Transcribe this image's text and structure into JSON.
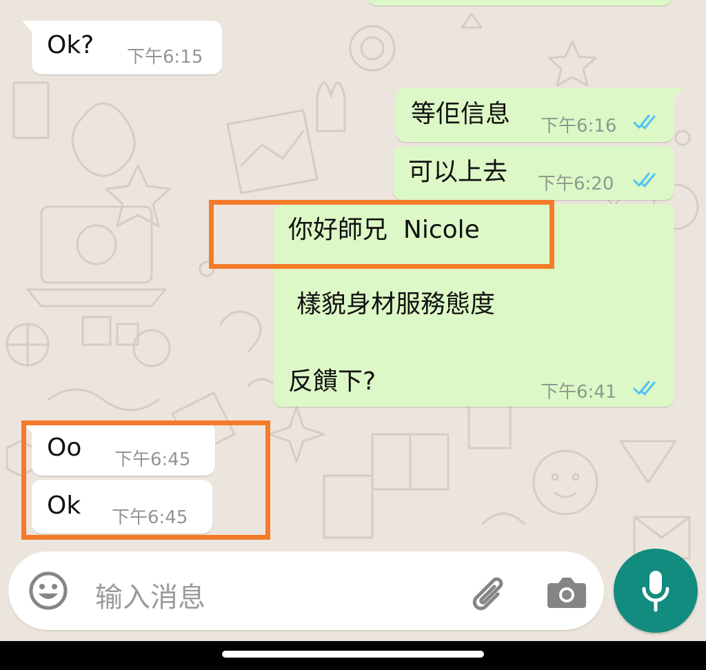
{
  "messages": [
    {
      "direction": "outgoing",
      "text": "",
      "time": "",
      "status": "partially visible"
    },
    {
      "direction": "incoming",
      "text": "Ok?",
      "time": "下午6:15"
    },
    {
      "direction": "outgoing",
      "text": "等佢信息",
      "time": "下午6:16",
      "status": "read"
    },
    {
      "direction": "outgoing",
      "text": "可以上去",
      "time": "下午6:20",
      "status": "read"
    },
    {
      "direction": "outgoing",
      "lines": [
        "你好師兄  Nicole",
        "樣貌身材服務態度",
        "反饋下?"
      ],
      "time": "下午6:41",
      "status": "read"
    },
    {
      "direction": "incoming",
      "text": "Oo",
      "time": "下午6:45"
    },
    {
      "direction": "incoming",
      "text": "Ok",
      "time": "下午6:45"
    }
  ],
  "composer": {
    "placeholder": "输入消息",
    "emoji_icon": "emoji-icon",
    "attach_icon": "paperclip-icon",
    "camera_icon": "camera-icon",
    "mic_icon": "microphone-icon"
  },
  "colors": {
    "wallpaper": "#ece5dd",
    "incoming_bubble": "#ffffff",
    "outgoing_bubble": "#dcf8c6",
    "read_ticks": "#4fc3f7",
    "highlight": "#f47b2a",
    "mic_button": "#128c7e"
  }
}
